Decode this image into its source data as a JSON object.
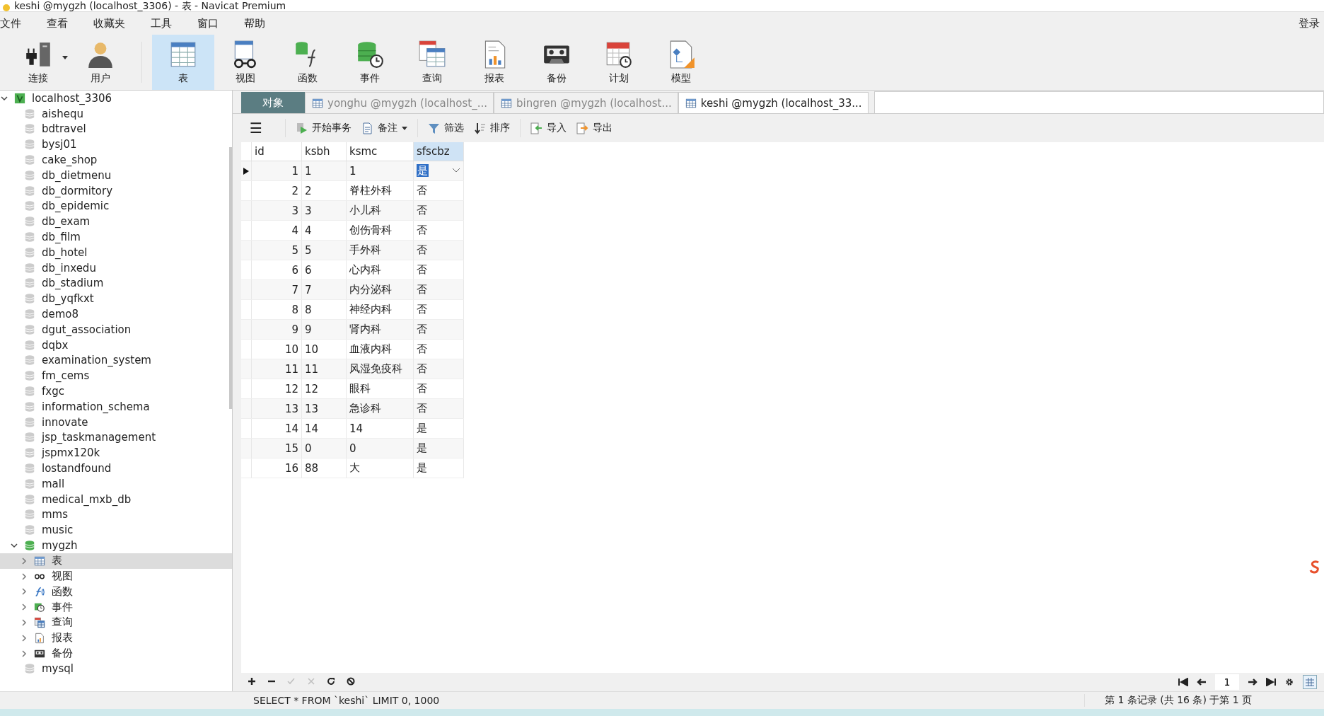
{
  "window": {
    "title": "keshi @mygzh (localhost_3306) - 表 - Navicat Premium"
  },
  "menu": [
    "文件",
    "查看",
    "收藏夹",
    "工具",
    "窗口",
    "帮助"
  ],
  "login": "登录",
  "toolbar": [
    {
      "kind": "connection",
      "label": "连接",
      "selected": false,
      "dropdown": true
    },
    {
      "kind": "user",
      "label": "用户",
      "selected": false,
      "dropdown": false
    },
    {
      "kind": "table",
      "label": "表",
      "selected": true,
      "dropdown": false
    },
    {
      "kind": "view",
      "label": "视图",
      "selected": false,
      "dropdown": false
    },
    {
      "kind": "function",
      "label": "函数",
      "selected": false,
      "dropdown": false
    },
    {
      "kind": "event",
      "label": "事件",
      "selected": false,
      "dropdown": false
    },
    {
      "kind": "query",
      "label": "查询",
      "selected": false,
      "dropdown": false
    },
    {
      "kind": "report",
      "label": "报表",
      "selected": false,
      "dropdown": false
    },
    {
      "kind": "backup",
      "label": "备份",
      "selected": false,
      "dropdown": false
    },
    {
      "kind": "schedule",
      "label": "计划",
      "selected": false,
      "dropdown": false
    },
    {
      "kind": "model",
      "label": "模型",
      "selected": false,
      "dropdown": false
    }
  ],
  "sidebar": {
    "tree": [
      {
        "kind": "server",
        "label": "localhost_3306",
        "expanded": true,
        "selected": false,
        "children": [
          {
            "kind": "database",
            "label": "aishequ",
            "selected": false
          },
          {
            "kind": "database",
            "label": "bdtravel",
            "selected": false
          },
          {
            "kind": "database",
            "label": "bysj01",
            "selected": false
          },
          {
            "kind": "database",
            "label": "cake_shop",
            "selected": false
          },
          {
            "kind": "database",
            "label": "db_dietmenu",
            "selected": false
          },
          {
            "kind": "database",
            "label": "db_dormitory",
            "selected": false
          },
          {
            "kind": "database",
            "label": "db_epidemic",
            "selected": false
          },
          {
            "kind": "database",
            "label": "db_exam",
            "selected": false
          },
          {
            "kind": "database",
            "label": "db_film",
            "selected": false
          },
          {
            "kind": "database",
            "label": "db_hotel",
            "selected": false
          },
          {
            "kind": "database",
            "label": "db_inxedu",
            "selected": false
          },
          {
            "kind": "database",
            "label": "db_stadium",
            "selected": false
          },
          {
            "kind": "database",
            "label": "db_yqfkxt",
            "selected": false
          },
          {
            "kind": "database",
            "label": "demo8",
            "selected": false
          },
          {
            "kind": "database",
            "label": "dgut_association",
            "selected": false
          },
          {
            "kind": "database",
            "label": "dqbx",
            "selected": false
          },
          {
            "kind": "database",
            "label": "examination_system",
            "selected": false
          },
          {
            "kind": "database",
            "label": "fm_cems",
            "selected": false
          },
          {
            "kind": "database",
            "label": "fxgc",
            "selected": false
          },
          {
            "kind": "database",
            "label": "information_schema",
            "selected": false
          },
          {
            "kind": "database",
            "label": "innovate",
            "selected": false
          },
          {
            "kind": "database",
            "label": "jsp_taskmanagement",
            "selected": false
          },
          {
            "kind": "database",
            "label": "jspmx120k",
            "selected": false
          },
          {
            "kind": "database",
            "label": "lostandfound",
            "selected": false
          },
          {
            "kind": "database",
            "label": "mall",
            "selected": false
          },
          {
            "kind": "database",
            "label": "medical_mxb_db",
            "selected": false
          },
          {
            "kind": "database",
            "label": "mms",
            "selected": false
          },
          {
            "kind": "database",
            "label": "music",
            "selected": false
          },
          {
            "kind": "database",
            "label": "mygzh",
            "expanded": true,
            "selected": false,
            "children": [
              {
                "kind": "table",
                "label": "表",
                "expanded": false,
                "selected": true
              },
              {
                "kind": "view",
                "label": "视图",
                "expanded": false,
                "selected": false
              },
              {
                "kind": "function",
                "label": "函数",
                "expanded": false,
                "selected": false
              },
              {
                "kind": "event",
                "label": "事件",
                "expanded": false,
                "selected": false
              },
              {
                "kind": "query",
                "label": "查询",
                "expanded": false,
                "selected": false
              },
              {
                "kind": "report",
                "label": "报表",
                "expanded": false,
                "selected": false
              },
              {
                "kind": "backup",
                "label": "备份",
                "expanded": false,
                "selected": false
              }
            ]
          },
          {
            "kind": "database",
            "label": "mysql",
            "selected": false
          }
        ]
      }
    ]
  },
  "tabs": [
    {
      "kind": "objects",
      "label": "对象",
      "selected": false
    },
    {
      "kind": "document",
      "label": "yonghu @mygzh (localhost_...",
      "selected": false
    },
    {
      "kind": "document",
      "label": "bingren @mygzh (localhost...",
      "selected": false
    },
    {
      "kind": "document",
      "label": "keshi @mygzh (localhost_33...",
      "selected": true
    }
  ],
  "table_toolbar": [
    {
      "kind": "menu",
      "label": "☰"
    },
    {
      "kind": "transaction",
      "label": "开始事务"
    },
    {
      "kind": "note",
      "label": "备注"
    },
    {
      "kind": "filter",
      "label": "筛选"
    },
    {
      "kind": "sort",
      "label": "排序"
    },
    {
      "kind": "import",
      "label": "导入"
    },
    {
      "kind": "export",
      "label": "导出"
    }
  ],
  "table": {
    "columns": [
      {
        "label": "id",
        "selected": false
      },
      {
        "label": "ksbh",
        "selected": false
      },
      {
        "label": "ksmc",
        "selected": false
      },
      {
        "label": "sfscbz",
        "selected": true
      }
    ],
    "rows": [
      {
        "cells": [
          "1",
          "1",
          "1",
          "是"
        ],
        "selected": true
      },
      {
        "cells": [
          "2",
          "2",
          "脊柱外科",
          "否"
        ],
        "selected": false
      },
      {
        "cells": [
          "3",
          "3",
          "小儿科",
          "否"
        ],
        "selected": false
      },
      {
        "cells": [
          "4",
          "4",
          "创伤骨科",
          "否"
        ],
        "selected": false
      },
      {
        "cells": [
          "5",
          "5",
          "手外科",
          "否"
        ],
        "selected": false
      },
      {
        "cells": [
          "6",
          "6",
          "心内科",
          "否"
        ],
        "selected": false
      },
      {
        "cells": [
          "7",
          "7",
          "内分泌科",
          "否"
        ],
        "selected": false
      },
      {
        "cells": [
          "8",
          "8",
          "神经内科",
          "否"
        ],
        "selected": false
      },
      {
        "cells": [
          "9",
          "9",
          "肾内科",
          "否"
        ],
        "selected": false
      },
      {
        "cells": [
          "10",
          "10",
          "血液内科",
          "否"
        ],
        "selected": false
      },
      {
        "cells": [
          "11",
          "11",
          "风湿免疫科",
          "否"
        ],
        "selected": false
      },
      {
        "cells": [
          "12",
          "12",
          "眼科",
          "否"
        ],
        "selected": false
      },
      {
        "cells": [
          "13",
          "13",
          "急诊科",
          "否"
        ],
        "selected": false
      },
      {
        "cells": [
          "14",
          "14",
          "14",
          "是"
        ],
        "selected": false
      },
      {
        "cells": [
          "15",
          "0",
          "0",
          "是"
        ],
        "selected": false
      },
      {
        "cells": [
          "16",
          "88",
          "大",
          "是"
        ],
        "selected": false
      }
    ]
  },
  "record_buttons": [
    {
      "kind": "add",
      "disabled": false
    },
    {
      "kind": "remove",
      "disabled": false
    },
    {
      "kind": "apply",
      "disabled": true
    },
    {
      "kind": "cancel",
      "disabled": true
    },
    {
      "kind": "refresh",
      "disabled": false
    },
    {
      "kind": "stop",
      "disabled": false
    }
  ],
  "pager": {
    "page": "1"
  },
  "status_bar": {
    "sql": "SELECT * FROM `keshi` LIMIT 0, 1000",
    "records": "第 1 条记录 (共 16 条) 于第 1 页"
  }
}
